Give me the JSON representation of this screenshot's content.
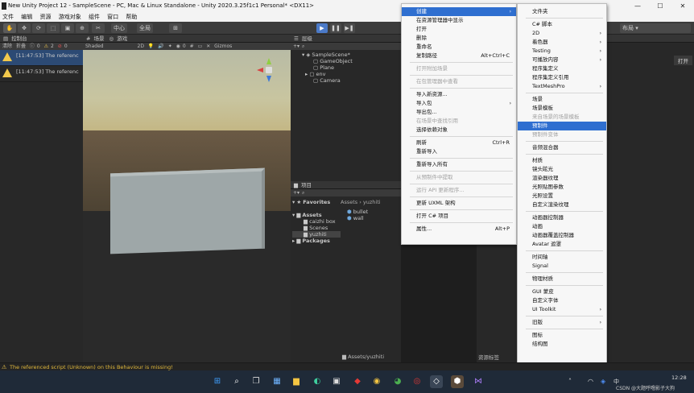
{
  "window": {
    "title": "New Unity Project 12 - SampleScene - PC, Mac & Linux Standalone - Unity 2020.3.25f1c1 Personal* <DX11>",
    "controls": [
      "—",
      "☐",
      "✕"
    ]
  },
  "menubar": [
    "文件",
    "编辑",
    "资源",
    "游戏对象",
    "组件",
    "窗口",
    "帮助"
  ],
  "toolbar": {
    "pivot": "中心",
    "global": "全局",
    "layout": "布局"
  },
  "console": {
    "tab": "控制台",
    "clear": "清除",
    "collapse": "折叠",
    "count_info": "0",
    "count_warn": "2",
    "count_error": "0",
    "rows": [
      {
        "text": "[11:47:53] The referenced"
      },
      {
        "text": "[11:47:53] The referenced"
      }
    ]
  },
  "scene": {
    "tab_scene": "场景",
    "tab_game": "游戏",
    "shading": "Shaded",
    "mode2d": "2D",
    "gizmos": "Gizmos",
    "layer_count": "0"
  },
  "hierarchy": {
    "tab": "层级",
    "scene_name": "SampleScene*",
    "items": [
      "GameObject",
      "Plane",
      "env",
      "Camera"
    ]
  },
  "project": {
    "tab": "项目",
    "favorites": "Favorites",
    "assets": "Assets",
    "asset_folders": [
      "caizhi box",
      "Scenes",
      "yuzhiti"
    ],
    "packages": "Packages",
    "breadcrumb_root": "Assets",
    "breadcrumb_child": "yuzhiti",
    "files": [
      "bullet",
      "wall"
    ],
    "bottom_path": "Assets/yuzhiti"
  },
  "inspector": {
    "open_button": "打开",
    "tag_label": "资源标签"
  },
  "context_menu": {
    "items": [
      {
        "label": "创建",
        "shortcut": "",
        "arrow": true,
        "state": "selected"
      },
      {
        "label": "在资源管理器中显示",
        "shortcut": "",
        "arrow": false,
        "state": "normal"
      },
      {
        "label": "打开",
        "shortcut": "",
        "arrow": false,
        "state": "normal"
      },
      {
        "label": "删除",
        "shortcut": "",
        "arrow": false,
        "state": "normal"
      },
      {
        "label": "重命名",
        "shortcut": "",
        "arrow": false,
        "state": "normal"
      },
      {
        "label": "复制路径",
        "shortcut": "Alt+Ctrl+C",
        "arrow": false,
        "state": "normal"
      },
      {
        "label": "打开附加场景",
        "shortcut": "",
        "arrow": false,
        "state": "disabled",
        "sep_before": true
      },
      {
        "label": "在包管理器中查看",
        "shortcut": "",
        "arrow": false,
        "state": "disabled",
        "sep_before": true
      },
      {
        "label": "导入新资源...",
        "shortcut": "",
        "arrow": false,
        "state": "normal",
        "sep_before": true
      },
      {
        "label": "导入包",
        "shortcut": "",
        "arrow": true,
        "state": "normal"
      },
      {
        "label": "导出包...",
        "shortcut": "",
        "arrow": false,
        "state": "normal"
      },
      {
        "label": "在场景中查找引用",
        "shortcut": "",
        "arrow": false,
        "state": "disabled"
      },
      {
        "label": "选择依赖对象",
        "shortcut": "",
        "arrow": false,
        "state": "normal"
      },
      {
        "label": "刷新",
        "shortcut": "Ctrl+R",
        "arrow": false,
        "state": "normal",
        "sep_before": true
      },
      {
        "label": "重新导入",
        "shortcut": "",
        "arrow": false,
        "state": "normal"
      },
      {
        "label": "重新导入所有",
        "shortcut": "",
        "arrow": false,
        "state": "normal",
        "sep_before": true
      },
      {
        "label": "从预制件中提取",
        "shortcut": "",
        "arrow": false,
        "state": "disabled",
        "sep_before": true
      },
      {
        "label": "运行 API 更新程序...",
        "shortcut": "",
        "arrow": false,
        "state": "disabled",
        "sep_before": true
      },
      {
        "label": "更新 UXML 架构",
        "shortcut": "",
        "arrow": false,
        "state": "normal",
        "sep_before": true
      },
      {
        "label": "打开 C# 项目",
        "shortcut": "",
        "arrow": false,
        "state": "normal",
        "sep_before": true
      },
      {
        "label": "属性...",
        "shortcut": "Alt+P",
        "arrow": false,
        "state": "normal",
        "sep_before": true
      }
    ]
  },
  "submenu": {
    "items": [
      {
        "label": "文件夹",
        "arrow": false,
        "state": "normal"
      },
      {
        "label": "C# 脚本",
        "arrow": false,
        "state": "normal",
        "sep_before": true
      },
      {
        "label": "2D",
        "arrow": true,
        "state": "normal"
      },
      {
        "label": "着色器",
        "arrow": true,
        "state": "normal"
      },
      {
        "label": "Testing",
        "arrow": true,
        "state": "normal"
      },
      {
        "label": "可播放内容",
        "arrow": true,
        "state": "normal"
      },
      {
        "label": "程序集定义",
        "arrow": false,
        "state": "normal"
      },
      {
        "label": "程序集定义引用",
        "arrow": false,
        "state": "normal"
      },
      {
        "label": "TextMeshPro",
        "arrow": true,
        "state": "normal"
      },
      {
        "label": "场景",
        "arrow": false,
        "state": "normal",
        "sep_before": true
      },
      {
        "label": "场景模板",
        "arrow": false,
        "state": "normal"
      },
      {
        "label": "来自场景的场景模板",
        "arrow": false,
        "state": "disabled"
      },
      {
        "label": "预制件",
        "arrow": false,
        "state": "selected"
      },
      {
        "label": "预制件变体",
        "arrow": false,
        "state": "disabled"
      },
      {
        "label": "音频混合器",
        "arrow": false,
        "state": "normal",
        "sep_before": true
      },
      {
        "label": "材质",
        "arrow": false,
        "state": "normal",
        "sep_before": true
      },
      {
        "label": "镜头眩光",
        "arrow": false,
        "state": "normal"
      },
      {
        "label": "渲染器纹理",
        "arrow": false,
        "state": "normal"
      },
      {
        "label": "光照贴图参数",
        "arrow": false,
        "state": "normal"
      },
      {
        "label": "光照设置",
        "arrow": false,
        "state": "normal"
      },
      {
        "label": "自定义渲染纹理",
        "arrow": false,
        "state": "normal"
      },
      {
        "label": "动画器控制器",
        "arrow": false,
        "state": "normal",
        "sep_before": true
      },
      {
        "label": "动画",
        "arrow": false,
        "state": "normal"
      },
      {
        "label": "动画器覆盖控制器",
        "arrow": false,
        "state": "normal"
      },
      {
        "label": "Avatar 遮罩",
        "arrow": false,
        "state": "normal"
      },
      {
        "label": "时间轴",
        "arrow": false,
        "state": "normal",
        "sep_before": true
      },
      {
        "label": "Signal",
        "arrow": false,
        "state": "normal"
      },
      {
        "label": "物理材质",
        "arrow": false,
        "state": "normal",
        "sep_before": true
      },
      {
        "label": "GUI 蒙皮",
        "arrow": false,
        "state": "normal",
        "sep_before": true
      },
      {
        "label": "自定义字体",
        "arrow": false,
        "state": "normal"
      },
      {
        "label": "UI Toolkit",
        "arrow": true,
        "state": "normal"
      },
      {
        "label": "旧版",
        "arrow": true,
        "state": "normal",
        "sep_before": true
      },
      {
        "label": "图标",
        "arrow": false,
        "state": "normal",
        "sep_before": true
      },
      {
        "label": "结构图",
        "arrow": false,
        "state": "normal"
      }
    ]
  },
  "status": {
    "message": "The referenced script (Unknown) on this Behaviour is missing!"
  },
  "taskbar": {
    "time": "12:28",
    "watermark": "CSDN @大题呼噜影子大狗",
    "tray": "中"
  }
}
